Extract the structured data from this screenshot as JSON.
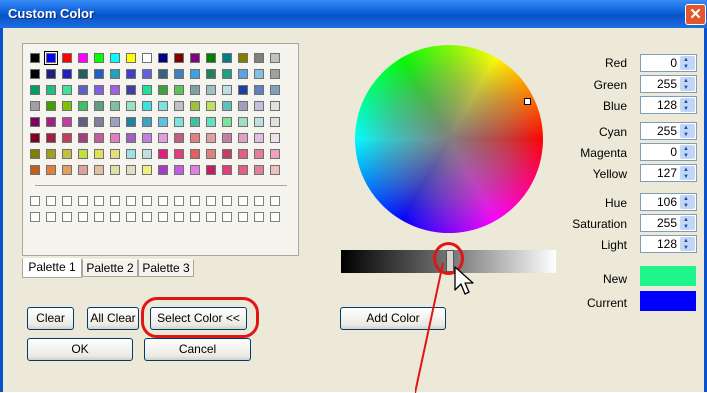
{
  "window": {
    "title": "Custom Color",
    "close_glyph": "✕"
  },
  "palette": {
    "rows": [
      [
        "#000000",
        "#0000ff",
        "#ff0000",
        "#ff00ff",
        "#00ff00",
        "#00ffff",
        "#ffff00",
        "#ffffff",
        "#000080",
        "#800000",
        "#800080",
        "#008000",
        "#008080",
        "#808000",
        "#808080",
        "#c0c0c0"
      ],
      [
        "#000000",
        "#202080",
        "#2020c0",
        "#206060",
        "#2060c0",
        "#20a0c0",
        "#4040c0",
        "#6060e0",
        "#406080",
        "#4080c0",
        "#40a0e0",
        "#208060",
        "#20a080",
        "#60a0e0",
        "#80c0e0",
        "#a0a0a0"
      ],
      [
        "#00a060",
        "#20c080",
        "#40e0a0",
        "#6060c0",
        "#8060e0",
        "#a060e0",
        "#4040a0",
        "#20e0a0",
        "#40a040",
        "#60c060",
        "#80a0a0",
        "#a0c0c0",
        "#c0e0e0",
        "#2040a0",
        "#6080c0",
        "#80a0c0"
      ],
      [
        "#a0a0a0",
        "#40a000",
        "#80c000",
        "#40c060",
        "#60a080",
        "#80c0a0",
        "#a0e0c0",
        "#40e0e0",
        "#80e0e0",
        "#c0c0c0",
        "#a0c040",
        "#c0e060",
        "#60c0c0",
        "#a0a0c0",
        "#c0c0e0",
        "#e0e0e0"
      ],
      [
        "#800060",
        "#a02080",
        "#c040a0",
        "#606080",
        "#8080a0",
        "#a0a0c0",
        "#2080a0",
        "#40a0c0",
        "#60c0e0",
        "#80e0e0",
        "#40c0a0",
        "#60e0c0",
        "#80e0a0",
        "#a0e0c0",
        "#c0e0e0",
        "#e0e0e0"
      ],
      [
        "#800020",
        "#a02040",
        "#c04060",
        "#a04080",
        "#c060a0",
        "#e080c0",
        "#a060c0",
        "#c080e0",
        "#e0a0e0",
        "#c06080",
        "#e08080",
        "#e0a0a0",
        "#c080a0",
        "#e0a0c0",
        "#e0c0e0",
        "#f0e0f0"
      ],
      [
        "#808000",
        "#a0a020",
        "#c0c040",
        "#c0e040",
        "#e0e060",
        "#e0e080",
        "#a0e0e0",
        "#c0e0e0",
        "#e02080",
        "#e04080",
        "#e06060",
        "#e08080",
        "#c04060",
        "#e06080",
        "#e080a0",
        "#f0a0c0"
      ],
      [
        "#c06020",
        "#e08040",
        "#e0a060",
        "#e0a0a0",
        "#e0c0a0",
        "#e0e0a0",
        "#e0e0c0",
        "#f0f080",
        "#a040c0",
        "#c060e0",
        "#e080e0",
        "#c02060",
        "#e04080",
        "#e06080",
        "#e080a0",
        "#f0c0c0"
      ]
    ]
  },
  "tabs": [
    "Palette 1",
    "Palette 2",
    "Palette 3"
  ],
  "buttons": {
    "clear": "Clear",
    "all_clear": "All Clear",
    "select_color": "Select Color <<",
    "ok": "OK",
    "cancel": "Cancel",
    "add_color": "Add Color"
  },
  "fields": {
    "red": {
      "label": "Red",
      "value": "0"
    },
    "green": {
      "label": "Green",
      "value": "255"
    },
    "blue": {
      "label": "Blue",
      "value": "128"
    },
    "cyan": {
      "label": "Cyan",
      "value": "255"
    },
    "magenta": {
      "label": "Magenta",
      "value": "0"
    },
    "yellow": {
      "label": "Yellow",
      "value": "127"
    },
    "hue": {
      "label": "Hue",
      "value": "106"
    },
    "saturation": {
      "label": "Saturation",
      "value": "255"
    },
    "light": {
      "label": "Light",
      "value": "128"
    }
  },
  "preview": {
    "new_label": "New",
    "new_color": "#1ef58a",
    "current_label": "Current",
    "current_color": "#0000ff"
  },
  "luminance": {
    "level_percent": 50
  },
  "annotation": {
    "color": "#e01616"
  }
}
